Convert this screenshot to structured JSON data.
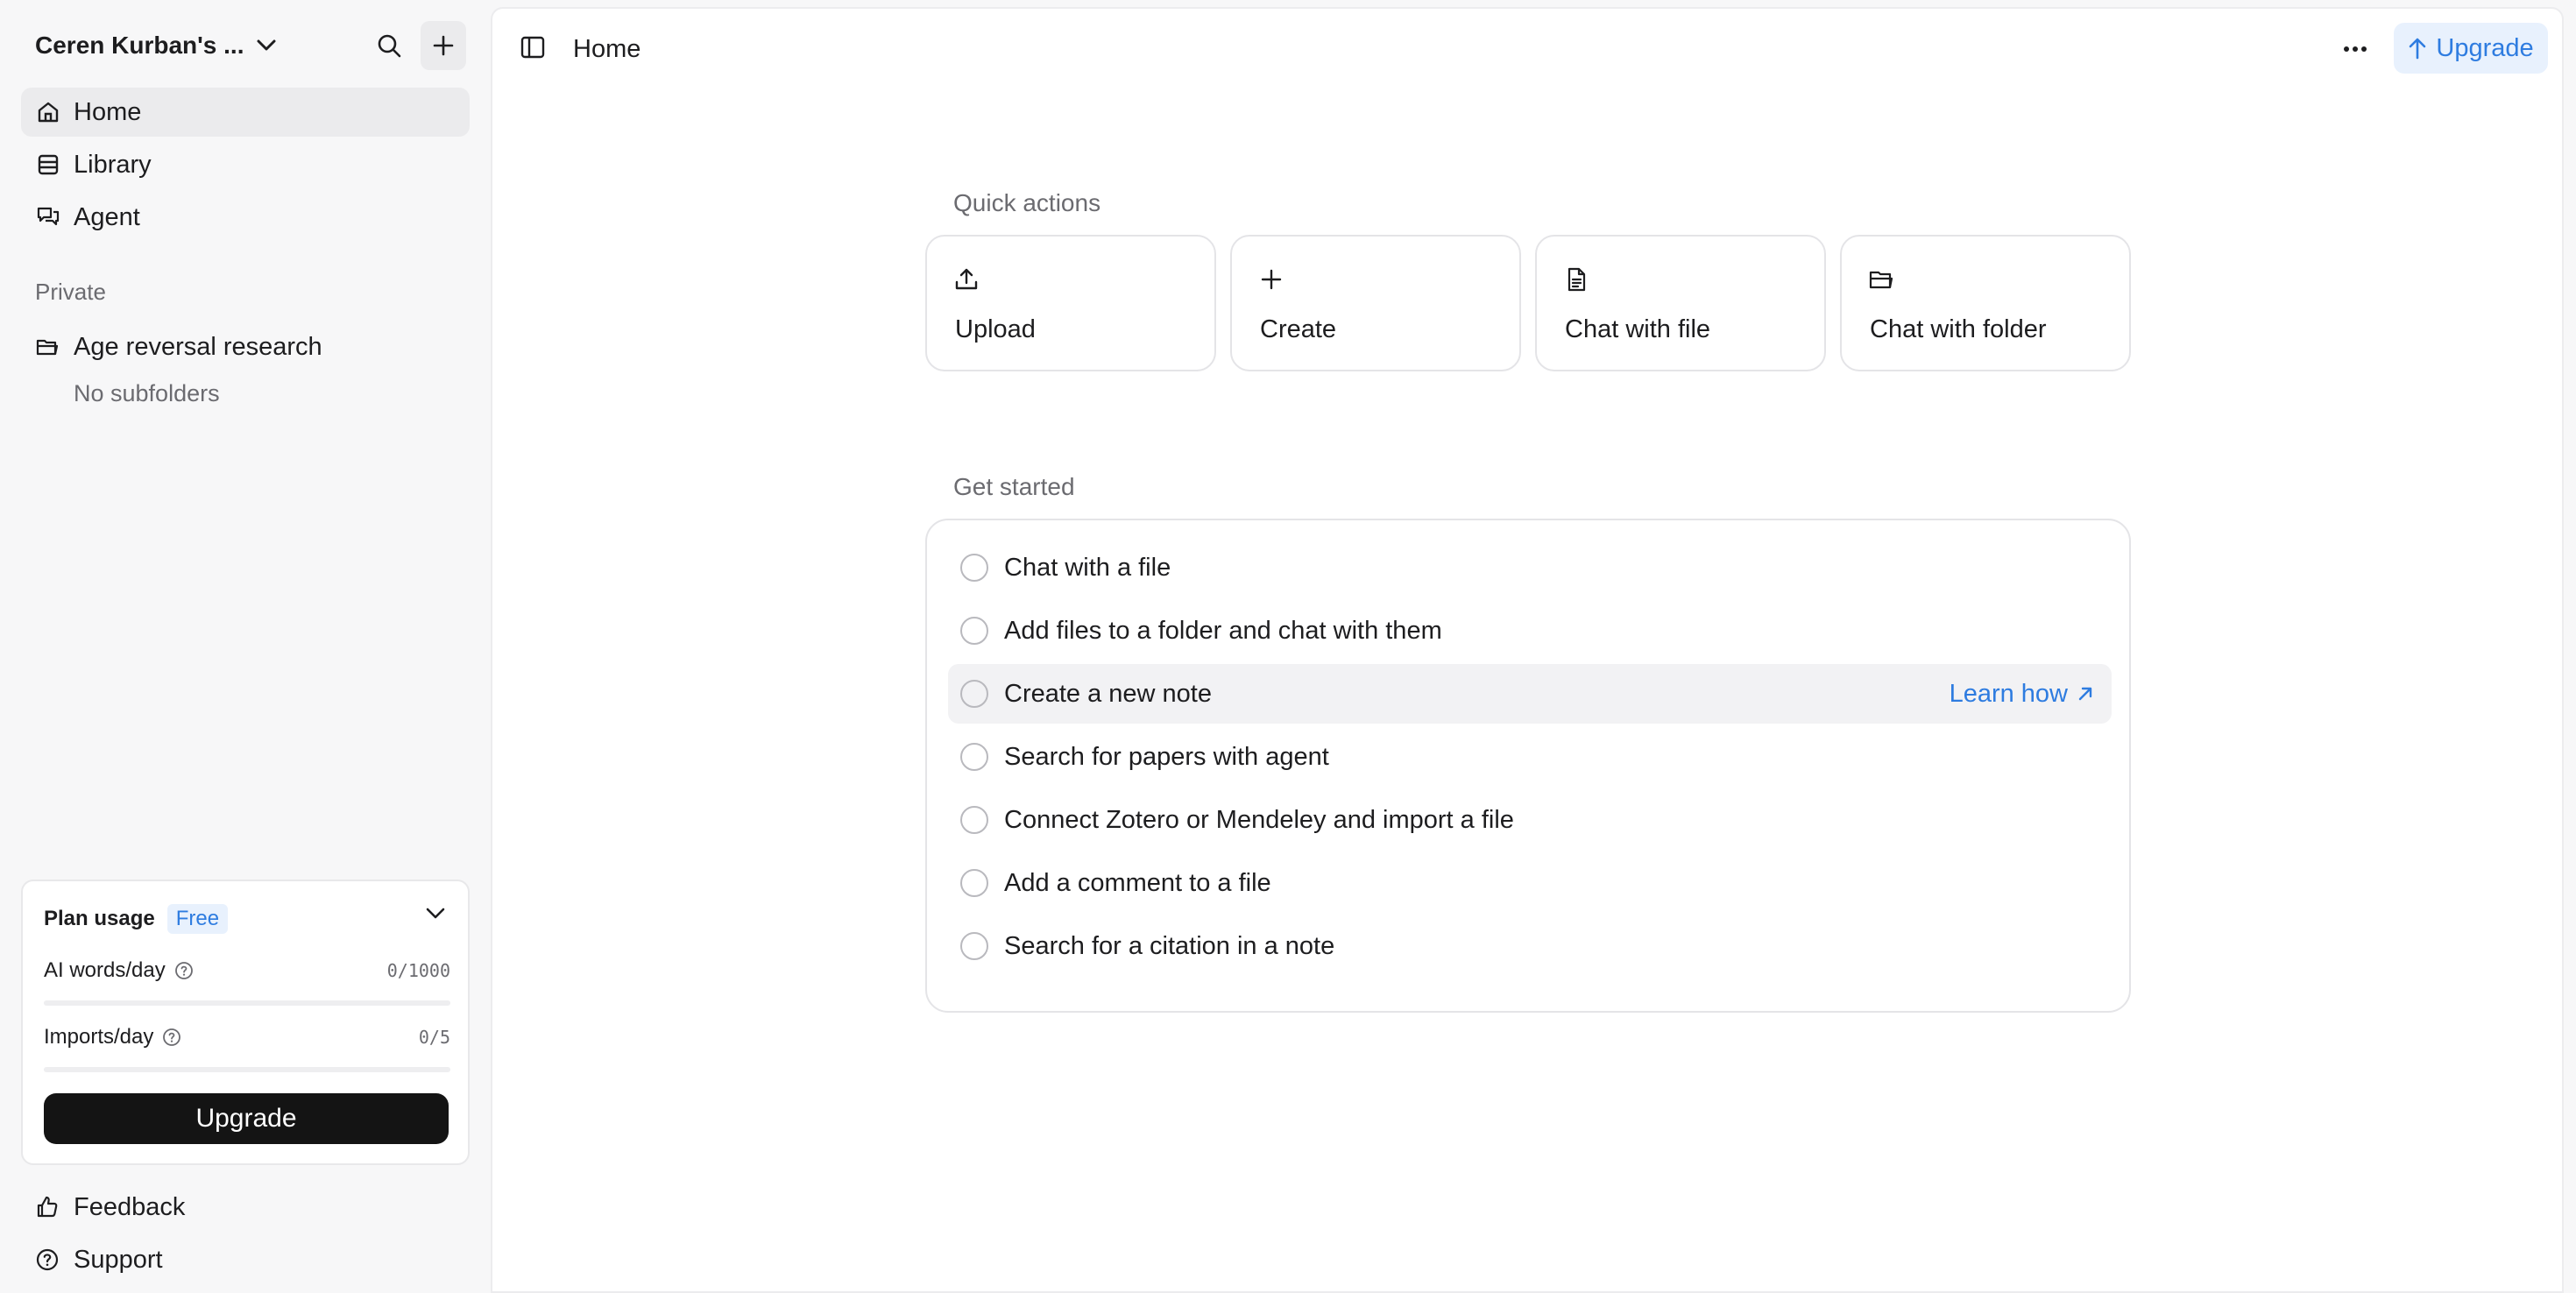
{
  "workspace": {
    "name": "Ceren Kurban's ..."
  },
  "sidebar": {
    "nav": [
      {
        "label": "Home",
        "icon": "home-icon",
        "active": true
      },
      {
        "label": "Library",
        "icon": "library-icon",
        "active": false
      },
      {
        "label": "Agent",
        "icon": "agent-icon",
        "active": false
      }
    ],
    "section_label": "Private",
    "folder": {
      "label": "Age reversal research",
      "icon": "folder-icon"
    },
    "no_subfolders": "No subfolders",
    "plan": {
      "title": "Plan usage",
      "badge": "Free",
      "ai_words_label": "AI words/day",
      "ai_words_value": "0/1000",
      "ai_words_fraction": 0,
      "imports_label": "Imports/day",
      "imports_value": "0/5",
      "imports_fraction": 0,
      "upgrade_label": "Upgrade"
    },
    "footer": [
      {
        "label": "Feedback",
        "icon": "thumbs-up-icon"
      },
      {
        "label": "Support",
        "icon": "help-circle-icon"
      }
    ]
  },
  "topbar": {
    "title": "Home",
    "upgrade_label": "Upgrade"
  },
  "quick_actions": {
    "label": "Quick actions",
    "items": [
      {
        "label": "Upload",
        "icon": "upload-icon"
      },
      {
        "label": "Create",
        "icon": "plus-icon"
      },
      {
        "label": "Chat with file",
        "icon": "file-icon"
      },
      {
        "label": "Chat with folder",
        "icon": "folder-icon"
      }
    ]
  },
  "get_started": {
    "label": "Get started",
    "learn_how": "Learn how",
    "items": [
      "Chat with a file",
      "Add files to a folder and chat with them",
      "Create a new note",
      "Search for papers with agent",
      "Connect Zotero or Mendeley and import a file",
      "Add a comment to a file",
      "Search for a citation in a note"
    ]
  },
  "colors": {
    "accent": "#2e7ce0",
    "accent_bg": "#e8f1fd",
    "primary_button": "#141414",
    "sidebar_bg": "#f7f7f8"
  }
}
